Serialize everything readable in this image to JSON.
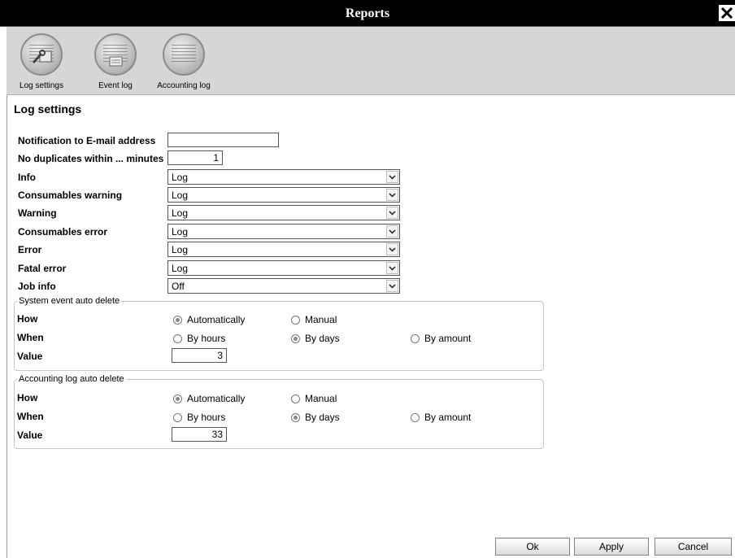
{
  "window": {
    "title": "Reports"
  },
  "toolbar": {
    "items": [
      {
        "label": "Log settings"
      },
      {
        "label": "Event log"
      },
      {
        "label": "Accounting log"
      }
    ]
  },
  "section": {
    "title": "Log settings"
  },
  "form": {
    "email_label": "Notification to E-mail address",
    "email_value": "",
    "nodup_label": "No duplicates within ... minutes",
    "nodup_value": "1",
    "selects": [
      {
        "label": "Info",
        "value": "Log"
      },
      {
        "label": "Consumables warning",
        "value": "Log"
      },
      {
        "label": "Warning",
        "value": "Log"
      },
      {
        "label": "Consumables error",
        "value": "Log"
      },
      {
        "label": "Error",
        "value": "Log"
      },
      {
        "label": "Fatal error",
        "value": "Log"
      },
      {
        "label": "Job info",
        "value": "Off"
      }
    ]
  },
  "system_delete": {
    "legend": "System event auto delete",
    "how_label": "How",
    "how_options": [
      "Automatically",
      "Manual"
    ],
    "how_selected": "Automatically",
    "when_label": "When",
    "when_options": [
      "By hours",
      "By days",
      "By amount"
    ],
    "when_selected": "By days",
    "value_label": "Value",
    "value": "3"
  },
  "accounting_delete": {
    "legend": "Accounting log auto delete",
    "how_label": "How",
    "how_options": [
      "Automatically",
      "Manual"
    ],
    "how_selected": "Automatically",
    "when_label": "When",
    "when_options": [
      "By hours",
      "By days",
      "By amount"
    ],
    "when_selected": "By days",
    "value_label": "Value",
    "value": "33"
  },
  "buttons": {
    "ok": "Ok",
    "apply": "Apply",
    "cancel": "Cancel"
  }
}
